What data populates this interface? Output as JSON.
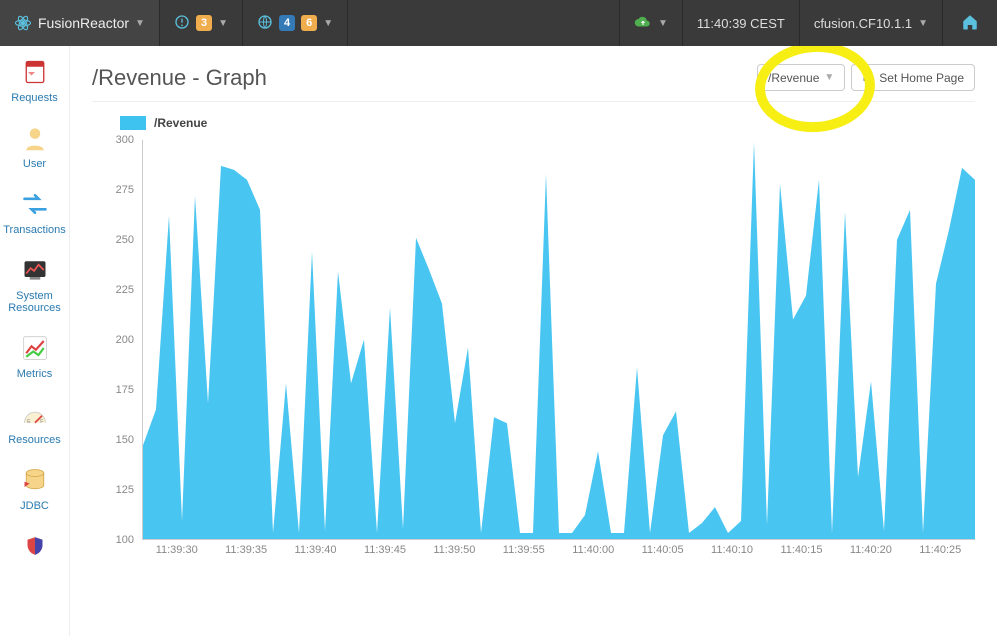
{
  "navbar": {
    "brand": "FusionReactor",
    "alerts_badge": "3",
    "net_badges": [
      "4",
      "6"
    ],
    "clock": "11:40:39 CEST",
    "instance": "cfusion.CF10.1.1"
  },
  "sidebar": {
    "items": [
      {
        "label": "Requests"
      },
      {
        "label": "User"
      },
      {
        "label": "Transactions"
      },
      {
        "label": "System Resources"
      },
      {
        "label": "Metrics"
      },
      {
        "label": "Resources"
      },
      {
        "label": "JDBC"
      }
    ]
  },
  "page": {
    "title": "/Revenue - Graph",
    "dropdown_label": "/Revenue",
    "set_home_label": "Set Home Page"
  },
  "chart_data": {
    "type": "area",
    "title": "/Revenue",
    "legend": "/Revenue",
    "ylabel": "",
    "xlabel": "",
    "ylim": [
      100,
      300
    ],
    "y_ticks": [
      100,
      125,
      150,
      175,
      200,
      225,
      250,
      275,
      300
    ],
    "x_ticks": [
      "11:39:30",
      "11:39:35",
      "11:39:40",
      "11:39:45",
      "11:39:50",
      "11:39:55",
      "11:40:00",
      "11:40:05",
      "11:40:10",
      "11:40:15",
      "11:40:20",
      "11:40:25"
    ],
    "series": [
      {
        "name": "/Revenue",
        "color": "#3ec2ef",
        "x": [
          0,
          1,
          2,
          3,
          4,
          5,
          6,
          7,
          8,
          9,
          10,
          11,
          12,
          13,
          14,
          15,
          16,
          17,
          18,
          19,
          20,
          21,
          22,
          23,
          24,
          25,
          26,
          27,
          28,
          29,
          30,
          31,
          32,
          33,
          34,
          35,
          36,
          37,
          38,
          39,
          40,
          41,
          42,
          43,
          44,
          45,
          46,
          47,
          48,
          49,
          50,
          51,
          52,
          53,
          54,
          55,
          56,
          57,
          58,
          59,
          60,
          61,
          62,
          63,
          64
        ],
        "values": [
          147,
          165,
          262,
          109,
          272,
          168,
          287,
          285,
          280,
          265,
          103,
          178,
          103,
          244,
          104,
          234,
          178,
          200,
          103,
          216,
          105,
          251,
          235,
          218,
          158,
          196,
          103,
          161,
          158,
          103,
          103,
          283,
          103,
          103,
          112,
          144,
          103,
          103,
          186,
          103,
          152,
          164,
          103,
          108,
          116,
          103,
          109,
          299,
          107,
          278,
          210,
          222,
          280,
          103,
          264,
          131,
          179,
          104,
          250,
          265,
          103,
          228,
          255,
          286,
          280
        ]
      }
    ]
  }
}
